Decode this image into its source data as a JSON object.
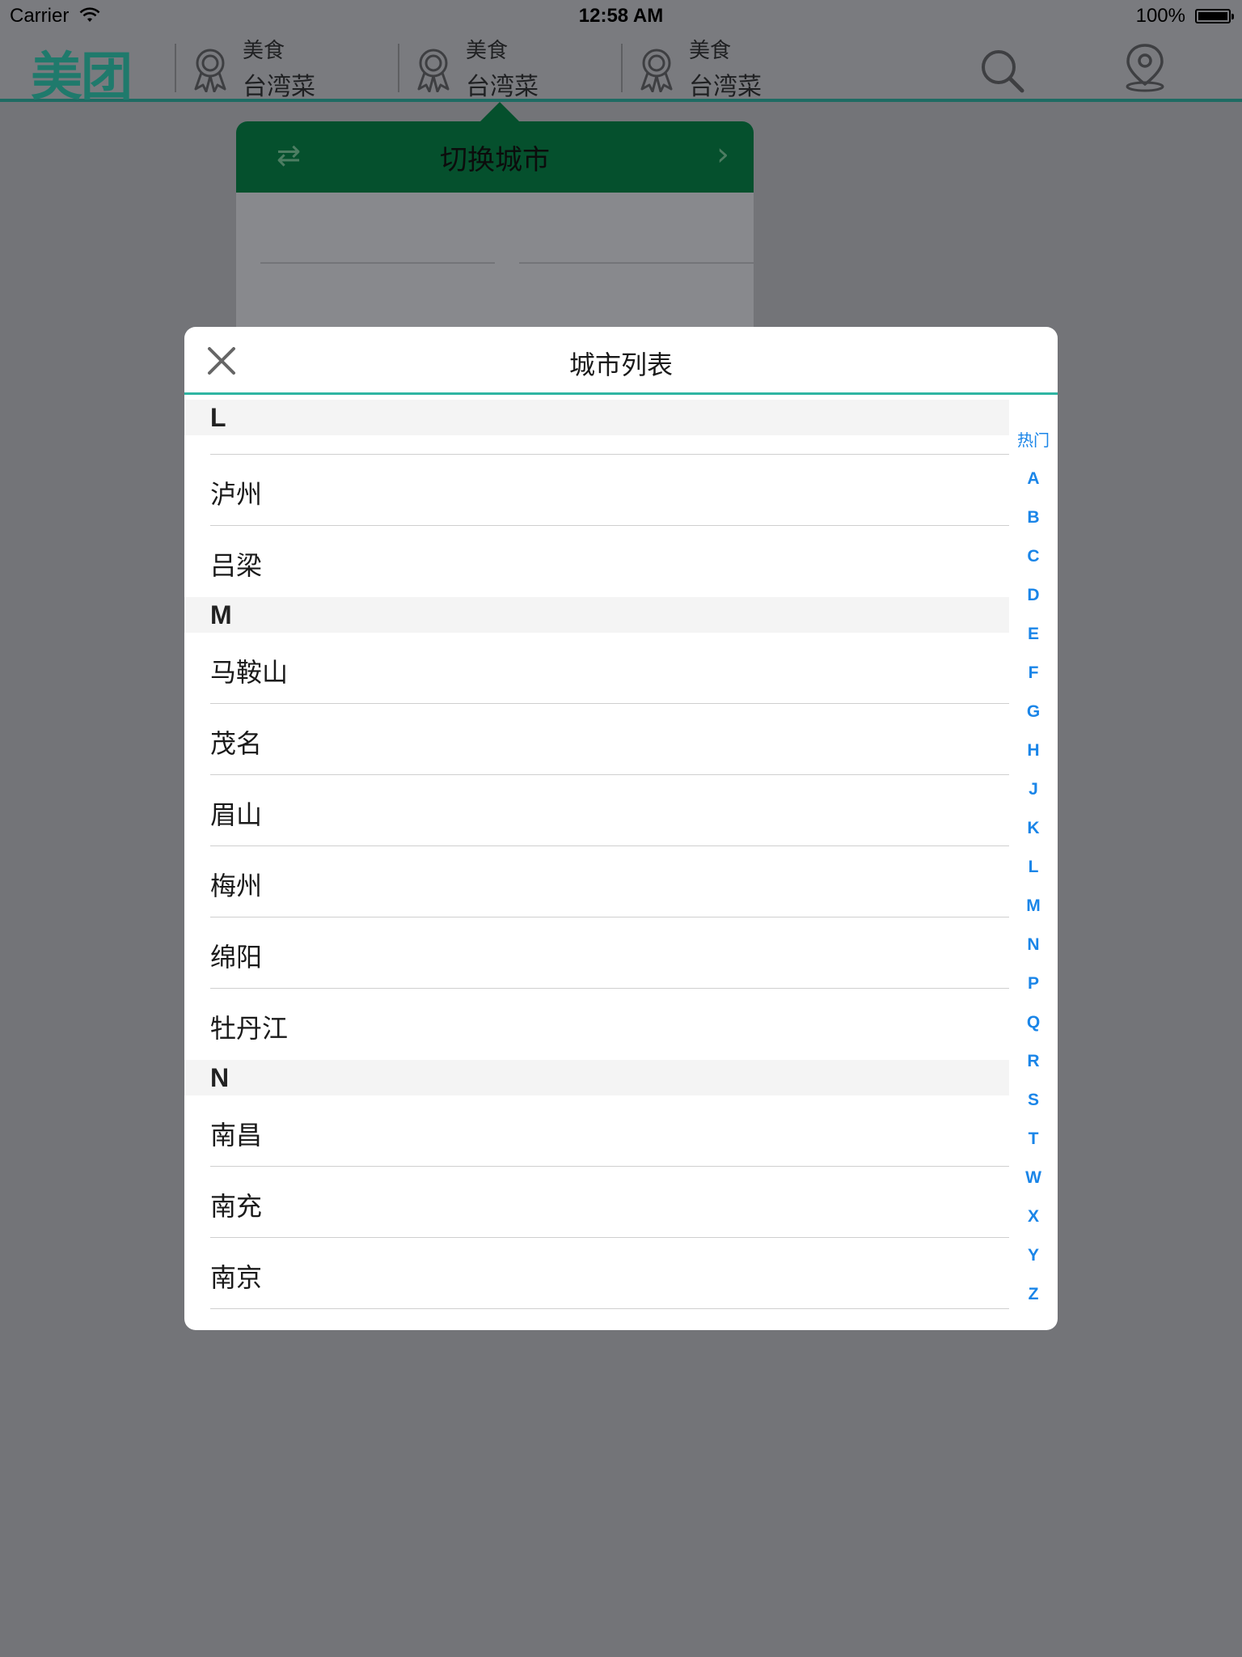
{
  "status_bar": {
    "carrier": "Carrier",
    "time": "12:58 AM",
    "battery": "100%"
  },
  "nav": {
    "logo": "美团",
    "items": [
      {
        "top": "美食",
        "bottom": "台湾菜"
      },
      {
        "top": "美食",
        "bottom": "台湾菜"
      },
      {
        "top": "美食",
        "bottom": "台湾菜"
      }
    ]
  },
  "popover": {
    "title": "切换城市"
  },
  "modal": {
    "title": "城市列表",
    "sections": [
      {
        "letter": "L",
        "cities": [
          "泸州",
          "吕梁"
        ]
      },
      {
        "letter": "M",
        "cities": [
          "马鞍山",
          "茂名",
          "眉山",
          "梅州",
          "绵阳",
          "牡丹江"
        ]
      },
      {
        "letter": "N",
        "cities": [
          "南昌",
          "南充",
          "南京"
        ]
      }
    ],
    "index": [
      "热门",
      "A",
      "B",
      "C",
      "D",
      "E",
      "F",
      "G",
      "H",
      "J",
      "K",
      "L",
      "M",
      "N",
      "P",
      "Q",
      "R",
      "S",
      "T",
      "W",
      "X",
      "Y",
      "Z"
    ]
  },
  "colors": {
    "accent": "#2fb5a3",
    "popover_head": "#05502d",
    "index": "#1a85e8"
  }
}
